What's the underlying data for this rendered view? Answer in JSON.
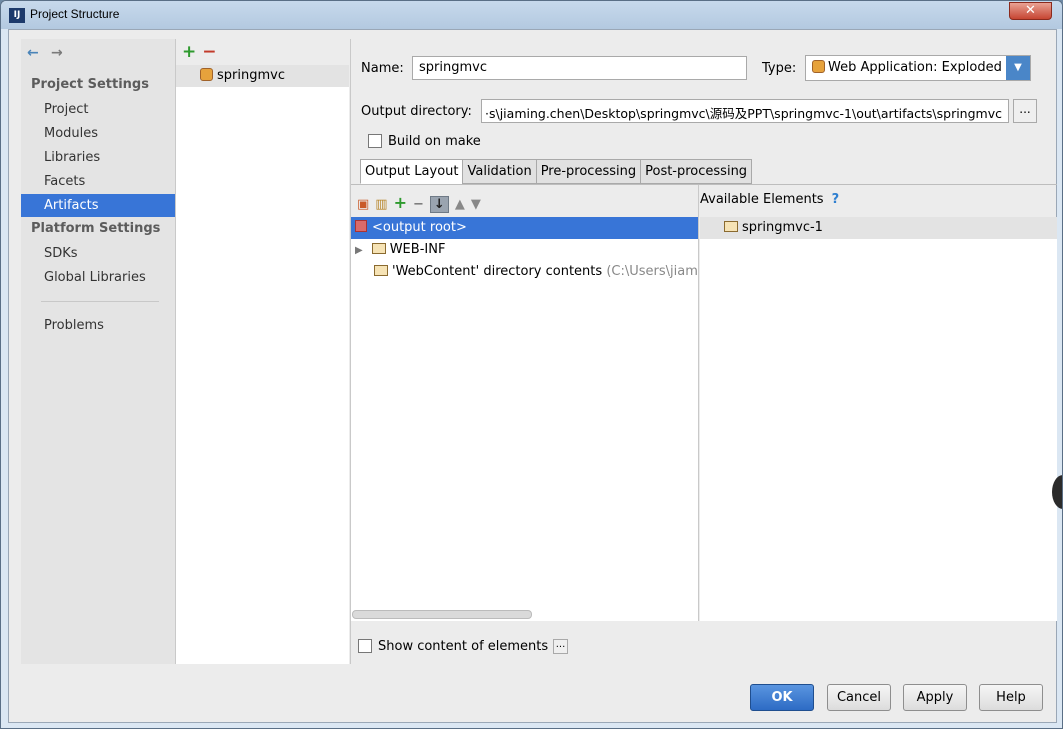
{
  "window": {
    "title": "Project Structure",
    "close_glyph": "✕"
  },
  "nav": {
    "back_icon": "←",
    "forward_icon": "→",
    "project_settings_header": "Project Settings",
    "project_items": [
      "Project",
      "Modules",
      "Libraries",
      "Facets",
      "Artifacts"
    ],
    "platform_settings_header": "Platform Settings",
    "platform_items": [
      "SDKs",
      "Global Libraries"
    ],
    "problems": "Problems",
    "selected": "Artifacts"
  },
  "artifact_list": {
    "add_icon": "+",
    "remove_icon": "−",
    "items": [
      "springmvc"
    ]
  },
  "detail": {
    "name_label": "Name:",
    "name_value": "springmvc",
    "type_label": "Type:",
    "type_value": "Web Application: Exploded",
    "output_dir_label": "Output directory:",
    "output_dir_value": "·s\\jiaming.chen\\Desktop\\springmvc\\源码及PPT\\springmvc-1\\out\\artifacts\\springmvc",
    "browse_label": "...",
    "build_on_make_label": "Build on make",
    "tabs": [
      "Output Layout",
      "Validation",
      "Pre-processing",
      "Post-processing"
    ],
    "active_tab": "Output Layout"
  },
  "layout_tree": {
    "rows": [
      {
        "text": "<output root>",
        "extra": ""
      },
      {
        "text": "WEB-INF",
        "extra": ""
      },
      {
        "text": "'WebContent' directory contents",
        "extra": "(C:\\Users\\jiaming"
      }
    ]
  },
  "available": {
    "header": "Available Elements",
    "help_icon": "?",
    "items": [
      "springmvc-1"
    ]
  },
  "bottom": {
    "show_content_label": "Show content of elements",
    "show_content_dots": "...",
    "ok": "OK",
    "cancel": "Cancel",
    "apply": "Apply",
    "help": "Help"
  },
  "colors": {
    "accent": "#3875d7",
    "ok_button": "#2d6bc4"
  }
}
